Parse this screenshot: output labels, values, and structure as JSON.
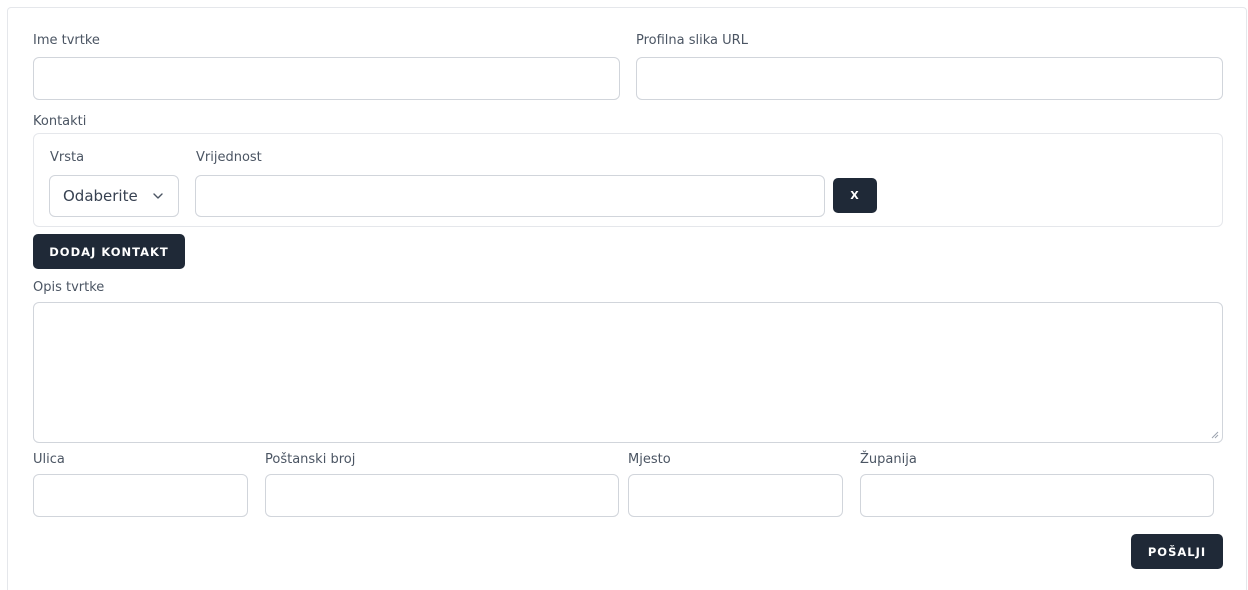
{
  "form": {
    "company_name_label": "Ime tvrtke",
    "profile_image_label": "Profilna slika URL",
    "contacts_label": "Kontakti",
    "contact": {
      "type_label": "Vrsta",
      "value_label": "Vrijednost",
      "type_selected": "Odaberite",
      "remove_label": "X"
    },
    "add_contact_label": "DODAJ KONTAKT",
    "description_label": "Opis tvrtke",
    "street_label": "Ulica",
    "postal_label": "Poštanski broj",
    "city_label": "Mjesto",
    "county_label": "Županija",
    "submit_label": "POŠALJI"
  },
  "icons": {
    "select": "chevron-down-icon",
    "textarea": "resize-grip-icon"
  },
  "colors": {
    "button_bg": "#1f2937",
    "border": "#d1d5db"
  }
}
